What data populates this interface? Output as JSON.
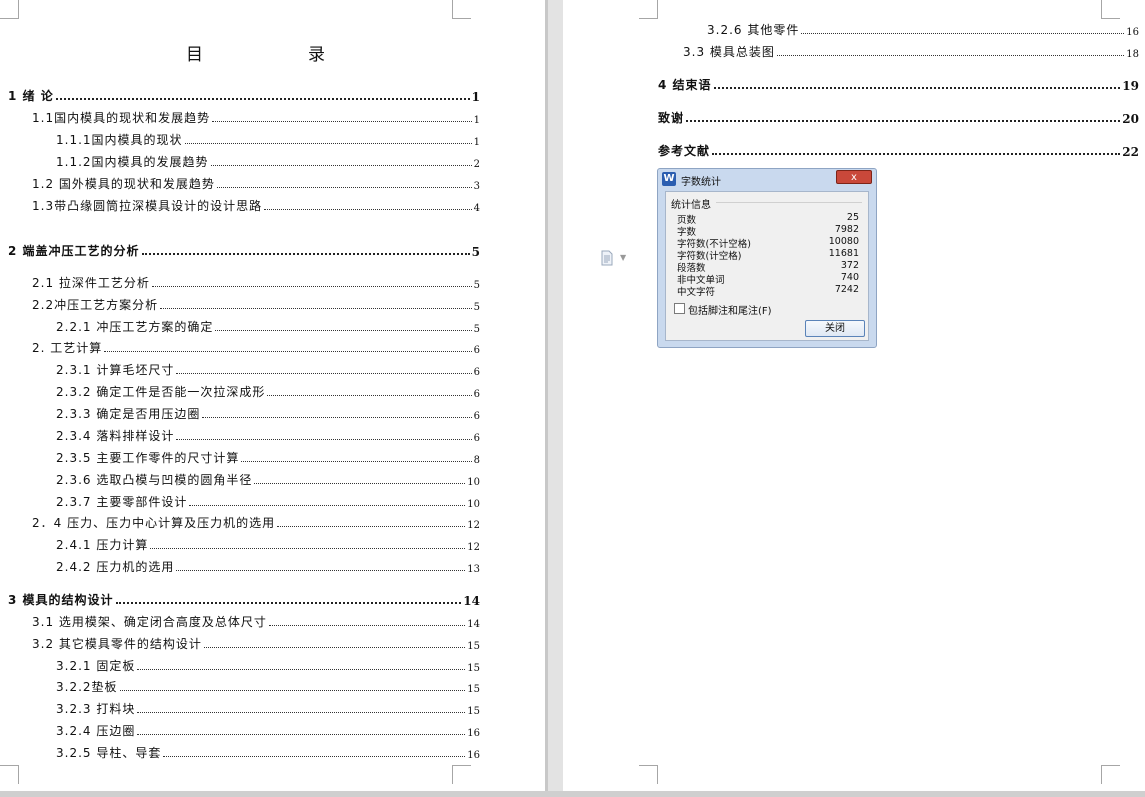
{
  "toc": {
    "title": "目　录",
    "left": [
      {
        "text": "1 绪 论",
        "page": "1",
        "bold": true
      },
      {
        "text": "1.1国内模具的现状和发展趋势",
        "page": "1"
      },
      {
        "text": "1.1.1国内模具的现状",
        "page": "1"
      },
      {
        "text": "1.1.2国内模具的发展趋势",
        "page": "2"
      },
      {
        "text": "1.2 国外模具的现状和发展趋势",
        "page": "3"
      },
      {
        "text": "1.3带凸缘圆筒拉深模具设计的设计思路",
        "page": "4"
      },
      {
        "text": "2 端盖冲压工艺的分析",
        "page": "5",
        "bold": true
      },
      {
        "text": "2.1 拉深件工艺分析",
        "page": "5"
      },
      {
        "text": "2.2冲压工艺方案分析",
        "page": "5"
      },
      {
        "text": "2.2.1 冲压工艺方案的确定",
        "page": "5"
      },
      {
        "text": "2. 工艺计算",
        "page": "6"
      },
      {
        "text": "2.3.1 计算毛坯尺寸",
        "page": "6"
      },
      {
        "text": "2.3.2 确定工件是否能一次拉深成形",
        "page": "6"
      },
      {
        "text": "2.3.3 确定是否用压边圈",
        "page": "6"
      },
      {
        "text": "2.3.4 落料排样设计",
        "page": "6"
      },
      {
        "text": "2.3.5 主要工作零件的尺寸计算",
        "page": "8"
      },
      {
        "text": "2.3.6 选取凸模与凹模的圆角半径",
        "page": "10"
      },
      {
        "text": "2.3.7 主要零部件设计",
        "page": "10"
      },
      {
        "text": "2．4 压力、压力中心计算及压力机的选用",
        "page": "12"
      },
      {
        "text": "2.4.1 压力计算",
        "page": "12"
      },
      {
        "text": "2.4.2 压力机的选用",
        "page": "13"
      },
      {
        "text": "3 模具的结构设计",
        "page": "14",
        "bold": true
      },
      {
        "text": "3.1 选用模架、确定闭合高度及总体尺寸",
        "page": "14"
      },
      {
        "text": "3.2 其它模具零件的结构设计",
        "page": "15"
      },
      {
        "text": "3.2.1 固定板",
        "page": "15"
      },
      {
        "text": "3.2.2垫板",
        "page": "15"
      },
      {
        "text": "3.2.3 打料块",
        "page": "15"
      },
      {
        "text": "3.2.4 压边圈",
        "page": "16"
      },
      {
        "text": "3.2.5 导柱、导套",
        "page": "16"
      }
    ],
    "right": [
      {
        "text": "3.2.6 其他零件",
        "page": "16"
      },
      {
        "text": "3.3 模具总装图",
        "page": "18"
      },
      {
        "text": "4 结束语",
        "page": "19",
        "bold": true
      },
      {
        "text": "致谢",
        "page": "20",
        "bold": true
      },
      {
        "text": "参考文献",
        "page": "22",
        "bold": true
      }
    ]
  },
  "dialog": {
    "title": "字数统计",
    "app_icon": "W",
    "close_icon": "x",
    "group_label": "统计信息",
    "stats": [
      {
        "label": "页数",
        "value": "25"
      },
      {
        "label": "字数",
        "value": "7982"
      },
      {
        "label": "字符数(不计空格)",
        "value": "10080"
      },
      {
        "label": "字符数(计空格)",
        "value": "11681"
      },
      {
        "label": "段落数",
        "value": "372"
      },
      {
        "label": "非中文单词",
        "value": "740"
      },
      {
        "label": "中文字符",
        "value": "7242"
      }
    ],
    "checkbox_label": "包括脚注和尾注(F)",
    "checkbox_checked": false,
    "close_button": "关闭"
  },
  "colors": {
    "workspace": "#d9d9d9",
    "page": "#ffffff",
    "dialog_frame": "#c9d9ee",
    "close_red": "#c9483a"
  }
}
